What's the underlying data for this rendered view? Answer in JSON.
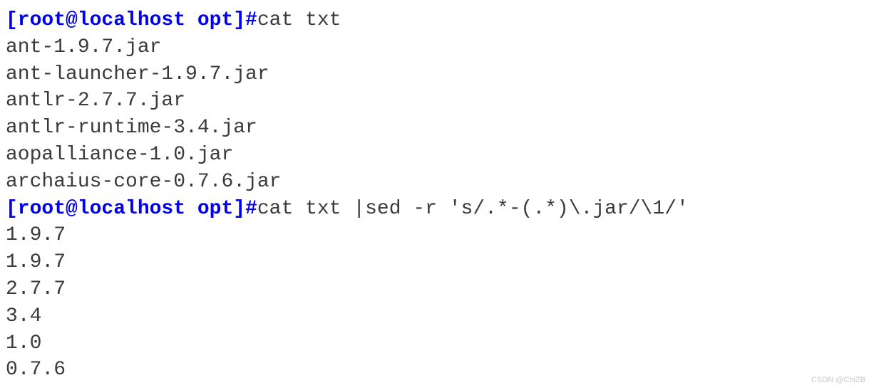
{
  "terminal": {
    "prompt": "[root@localhost opt]#",
    "commands": [
      {
        "cmd": "cat txt",
        "output": [
          "ant-1.9.7.jar",
          "ant-launcher-1.9.7.jar",
          "antlr-2.7.7.jar",
          "antlr-runtime-3.4.jar",
          "aopalliance-1.0.jar",
          "archaius-core-0.7.6.jar"
        ]
      },
      {
        "cmd": "cat txt |sed -r 's/.*-(.*)\\.jar/\\1/'",
        "output": [
          "1.9.7",
          "1.9.7",
          "2.7.7",
          "3.4",
          "1.0",
          "0.7.6"
        ]
      }
    ]
  },
  "watermark": "CSDN @ChiZB"
}
